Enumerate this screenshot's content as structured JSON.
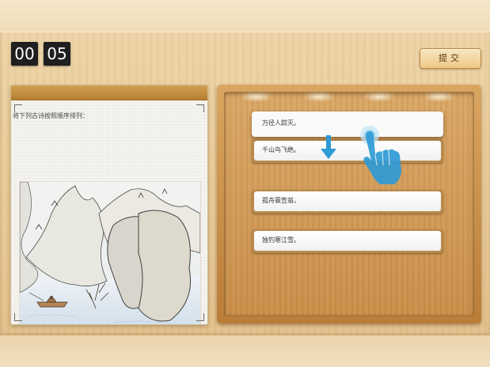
{
  "timer": {
    "minutes": "00",
    "seconds": "05"
  },
  "toolbar": {
    "submit_label": "提交"
  },
  "question": {
    "prompt": "将下列古诗按照顺序排列："
  },
  "poem_lines": [
    {
      "text": "万径人踪灭。",
      "state": "dragging"
    },
    {
      "text": "千山鸟飞绝。",
      "state": "partially-covered"
    },
    {
      "text": "孤舟蓑笠翁，",
      "state": "placed"
    },
    {
      "text": "独钓寒江雪。",
      "state": "placed"
    }
  ],
  "icons": {
    "drag_arrow": "arrow-down-icon",
    "touch_hand": "hand-pointer-icon"
  },
  "colors": {
    "accent_blue": "#2f9ad6",
    "timer_bg": "#1f1f1f",
    "wood_light": "#eed4a6",
    "wood_dark": "#b97d38"
  }
}
